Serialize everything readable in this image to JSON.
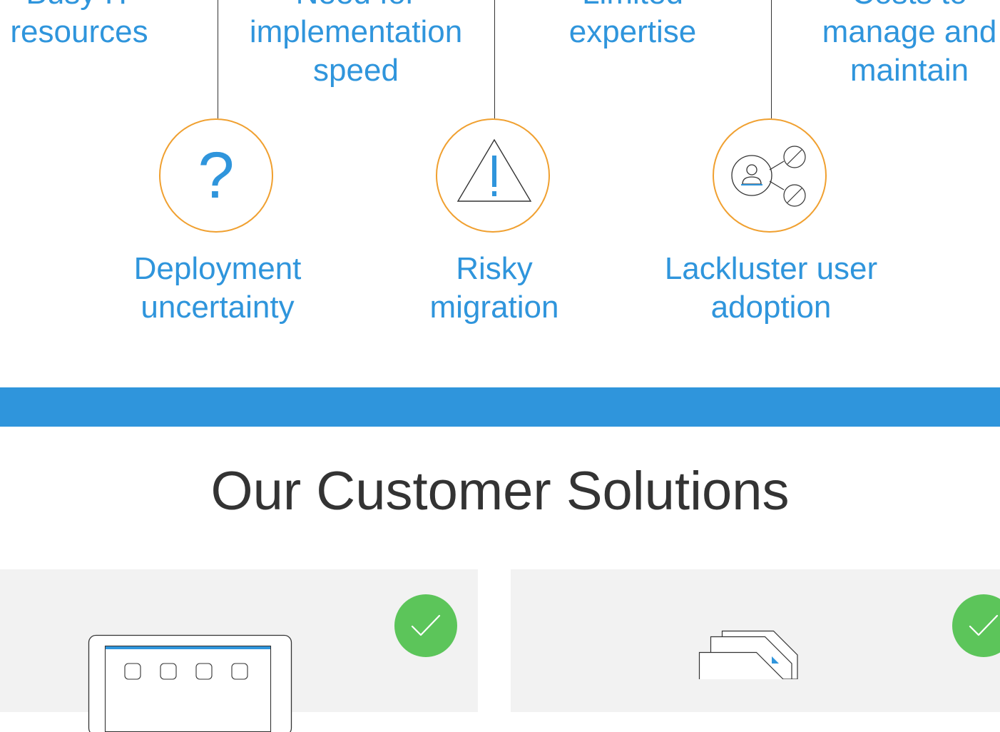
{
  "challenges_top": [
    {
      "label": "Busy IT\nresources"
    },
    {
      "label": "Need for\nimplementation\nspeed"
    },
    {
      "label": "Limited\nexpertise"
    },
    {
      "label": "Costs to\nmanage and\nmaintain"
    }
  ],
  "challenges_bottom": [
    {
      "label": "Deployment\nuncertainty",
      "icon": "question-mark-icon",
      "glyph": "?"
    },
    {
      "label": "Risky\nmigration",
      "icon": "warning-triangle-icon",
      "glyph": "!"
    },
    {
      "label": "Lackluster user\nadoption",
      "icon": "user-share-blocked-icon"
    }
  ],
  "solutions": {
    "title": "Our Customer Solutions",
    "cards": [
      {
        "icon": "tablet-dashboard-icon",
        "badge": "checkmark-icon"
      },
      {
        "icon": "stacked-documents-icon",
        "badge": "checkmark-icon"
      }
    ]
  },
  "colors": {
    "accent_blue": "#2f95dc",
    "circle_orange": "#f0a030",
    "title_text": "#333333",
    "card_background": "#f2f2f2",
    "check_green": "#5cc55a"
  }
}
